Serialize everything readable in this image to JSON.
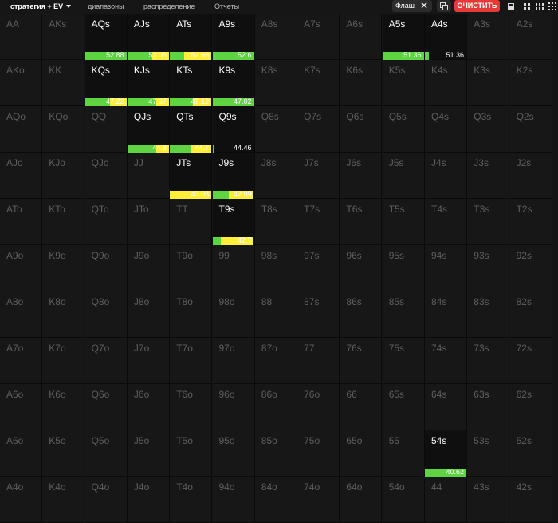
{
  "tabs": [
    {
      "label": "стратегия + EV",
      "active": true
    },
    {
      "label": "диапазоны",
      "active": false
    },
    {
      "label": "распределение",
      "active": false
    },
    {
      "label": "Отчеты",
      "active": false
    }
  ],
  "filter": {
    "label": "Флаш",
    "close": "✕"
  },
  "toolbar": {
    "clear_label": "ОЧИСТИТЬ"
  },
  "colors": {
    "green": "#5fd443",
    "yellow": "#ffef3a",
    "clear": "#e63a3a"
  },
  "grid": {
    "rows": [
      [
        "AA",
        "AKs",
        "AQs",
        "AJs",
        "ATs",
        "A9s",
        "A8s",
        "A7s",
        "A6s",
        "A5s",
        "A4s",
        "A3s",
        "A2s"
      ],
      [
        "AKo",
        "KK",
        "KQs",
        "KJs",
        "KTs",
        "K9s",
        "K8s",
        "K7s",
        "K6s",
        "K5s",
        "K4s",
        "K3s",
        "K2s"
      ],
      [
        "AQo",
        "KQo",
        "QQ",
        "QJs",
        "QTs",
        "Q9s",
        "Q8s",
        "Q7s",
        "Q6s",
        "Q5s",
        "Q4s",
        "Q3s",
        "Q2s"
      ],
      [
        "AJo",
        "KJo",
        "QJo",
        "JJ",
        "JTs",
        "J9s",
        "J8s",
        "J7s",
        "J6s",
        "J5s",
        "J4s",
        "J3s",
        "J2s"
      ],
      [
        "ATo",
        "KTo",
        "QTo",
        "JTo",
        "TT",
        "T9s",
        "T8s",
        "T7s",
        "T6s",
        "T5s",
        "T4s",
        "T3s",
        "T2s"
      ],
      [
        "A9o",
        "K9o",
        "Q9o",
        "J9o",
        "T9o",
        "99",
        "98s",
        "97s",
        "96s",
        "95s",
        "94s",
        "93s",
        "92s"
      ],
      [
        "A8o",
        "K8o",
        "Q8o",
        "J8o",
        "T8o",
        "98o",
        "88",
        "87s",
        "86s",
        "85s",
        "84s",
        "83s",
        "82s"
      ],
      [
        "A7o",
        "K7o",
        "Q7o",
        "J7o",
        "T7o",
        "97o",
        "87o",
        "77",
        "76s",
        "75s",
        "74s",
        "73s",
        "72s"
      ],
      [
        "A6o",
        "K6o",
        "Q6o",
        "J6o",
        "T6o",
        "96o",
        "86o",
        "76o",
        "66",
        "65s",
        "64s",
        "63s",
        "62s"
      ],
      [
        "A5o",
        "K5o",
        "Q5o",
        "J5o",
        "T5o",
        "95o",
        "85o",
        "75o",
        "65o",
        "55",
        "54s",
        "53s",
        "52s"
      ],
      [
        "A4o",
        "K4o",
        "Q4o",
        "J4o",
        "T4o",
        "94o",
        "84o",
        "74o",
        "64o",
        "54o",
        "44",
        "43s",
        "42s"
      ]
    ],
    "actions": {
      "AQs": {
        "ev": "52.88",
        "mix": [
          {
            "c": "green",
            "p": 1.0
          }
        ]
      },
      "AJs": {
        "ev": "53.05",
        "mix": [
          {
            "c": "green",
            "p": 0.6
          },
          {
            "c": "yellow",
            "p": 0.4
          }
        ]
      },
      "ATs": {
        "ev": "52.66",
        "mix": [
          {
            "c": "green",
            "p": 0.35
          },
          {
            "c": "yellow",
            "p": 0.65
          }
        ]
      },
      "A9s": {
        "ev": "52.6",
        "mix": [
          {
            "c": "green",
            "p": 1.0
          }
        ]
      },
      "A5s": {
        "ev": "51.36",
        "mix": [
          {
            "c": "green",
            "p": 1.0
          }
        ]
      },
      "A4s": {
        "ev": "51.36",
        "mix": [
          {
            "c": "green",
            "p": 0.1
          }
        ]
      },
      "KQs": {
        "ev": "47.22",
        "mix": [
          {
            "c": "green",
            "p": 0.6
          },
          {
            "c": "yellow",
            "p": 0.4
          }
        ]
      },
      "KJs": {
        "ev": "47.37",
        "mix": [
          {
            "c": "green",
            "p": 0.7
          },
          {
            "c": "yellow",
            "p": 0.3
          }
        ]
      },
      "KTs": {
        "ev": "47.12",
        "mix": [
          {
            "c": "green",
            "p": 0.55
          },
          {
            "c": "yellow",
            "p": 0.45
          }
        ]
      },
      "K9s": {
        "ev": "47.02",
        "mix": [
          {
            "c": "green",
            "p": 1.0
          }
        ]
      },
      "QJs": {
        "ev": "44.8",
        "mix": [
          {
            "c": "green",
            "p": 0.7
          },
          {
            "c": "yellow",
            "p": 0.3
          }
        ]
      },
      "QTs": {
        "ev": "44.7",
        "mix": [
          {
            "c": "green",
            "p": 0.5
          },
          {
            "c": "yellow",
            "p": 0.5
          }
        ]
      },
      "Q9s": {
        "ev": "44.46",
        "mix": [
          {
            "c": "green",
            "p": 0.05
          }
        ]
      },
      "JTs": {
        "ev": "43.08",
        "mix": [
          {
            "c": "yellow",
            "p": 1.0
          }
        ]
      },
      "J9s": {
        "ev": "42.99",
        "mix": [
          {
            "c": "green",
            "p": 0.4
          },
          {
            "c": "yellow",
            "p": 0.6
          }
        ]
      },
      "T9s": {
        "ev": "42.7",
        "mix": [
          {
            "c": "green",
            "p": 0.2
          },
          {
            "c": "yellow",
            "p": 0.8
          }
        ]
      },
      "54s": {
        "ev": "40.62",
        "mix": [
          {
            "c": "green",
            "p": 1.0
          }
        ]
      }
    }
  }
}
